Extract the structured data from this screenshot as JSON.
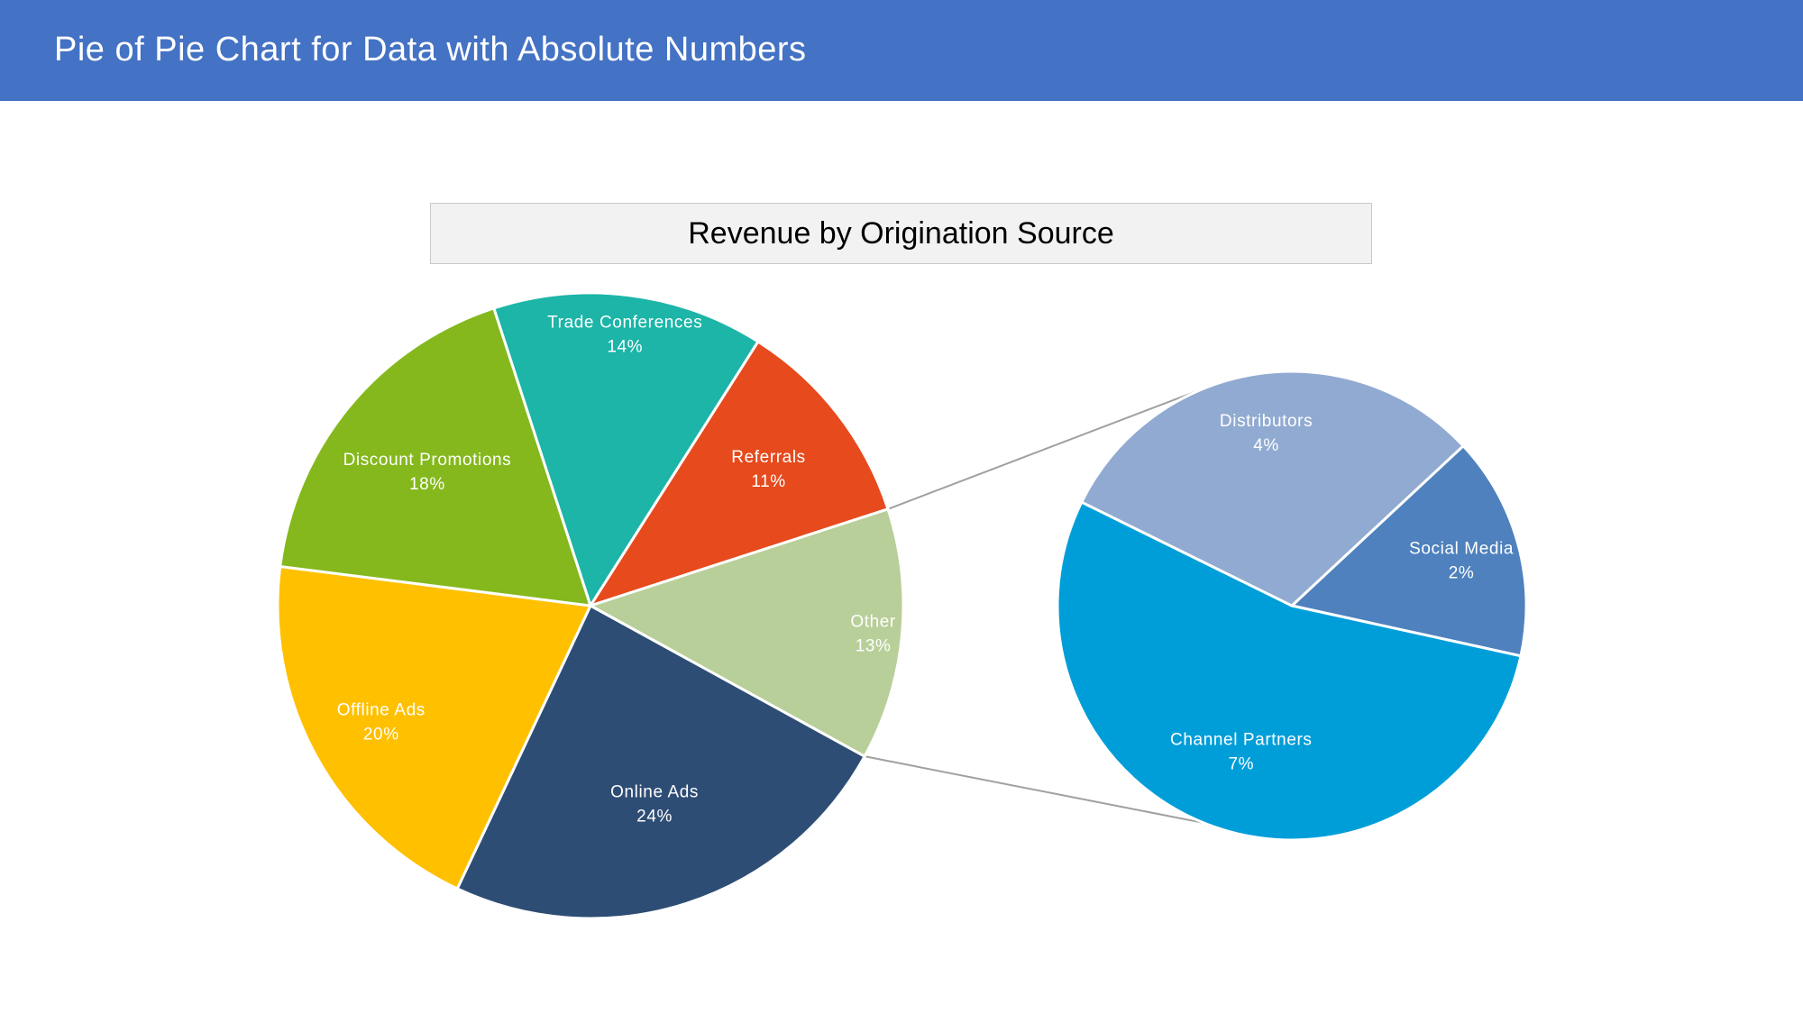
{
  "header": {
    "title": "Pie of Pie Chart for Data with Absolute Numbers"
  },
  "chart_data": {
    "type": "pie",
    "subtype": "pie-of-pie",
    "title": "Revenue by Origination Source",
    "main_pie": [
      {
        "label": "Trade Conferences",
        "value": 14,
        "display": "14%",
        "color": "#1cb5a8"
      },
      {
        "label": "Referrals",
        "value": 11,
        "display": "11%",
        "color": "#e64a1d"
      },
      {
        "label": "Other",
        "value": 13,
        "display": "13%",
        "color": "#b8cf99"
      },
      {
        "label": "Online Ads",
        "value": 24,
        "display": "24%",
        "color": "#2e4d75"
      },
      {
        "label": "Offline Ads",
        "value": 20,
        "display": "20%",
        "color": "#ffc000"
      },
      {
        "label": "Discount Promotions",
        "value": 18,
        "display": "18%",
        "color": "#84b81c"
      }
    ],
    "secondary_pie": [
      {
        "label": "Social Media",
        "value": 2,
        "display": "2%",
        "color": "#4e81bd"
      },
      {
        "label": "Channel Partners",
        "value": 7,
        "display": "7%",
        "color": "#009ed9"
      },
      {
        "label": "Distributors",
        "value": 4,
        "display": "4%",
        "color": "#91aad1"
      }
    ],
    "connector_color": "#a0a0a0",
    "legend": "none"
  }
}
